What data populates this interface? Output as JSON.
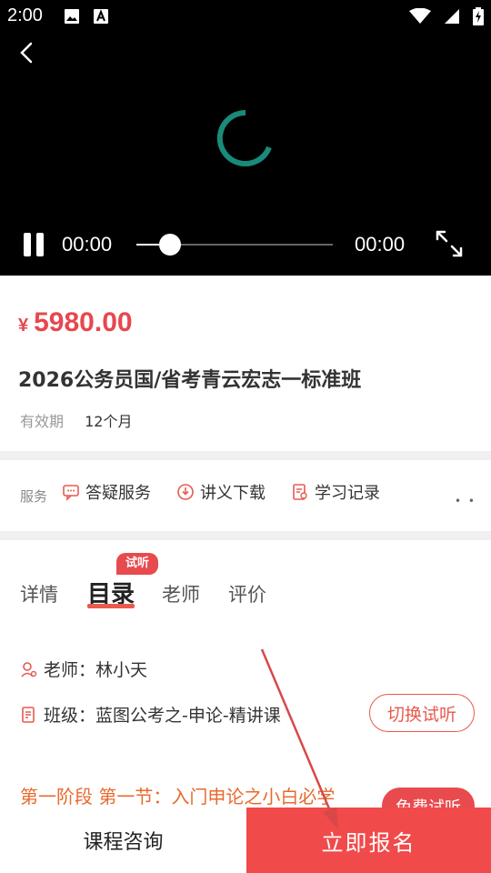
{
  "status_bar": {
    "time": "2:00"
  },
  "player": {
    "current_time": "00:00",
    "duration": "00:00",
    "progress_fraction": 0.17,
    "accent_color": "#1a8a7a"
  },
  "course": {
    "currency": "¥",
    "price": "5980.00",
    "title": "2026公务员国/省考青云宏志一标准班",
    "validity_label": "有效期",
    "validity_value": "12个月"
  },
  "services": {
    "label": "服务",
    "items": [
      {
        "label": "答疑服务",
        "icon": "chat-icon"
      },
      {
        "label": "讲义下载",
        "icon": "download-icon"
      },
      {
        "label": "学习记录",
        "icon": "record-icon"
      }
    ],
    "more": "• •"
  },
  "tabs": {
    "items": [
      "详情",
      "目录",
      "老师",
      "评价"
    ],
    "active_index": 1,
    "badge": "试听"
  },
  "catalog": {
    "teacher_label": "老师：林小天",
    "class_label": "班级：蓝图公考之-申论-精讲课",
    "switch_button": "切换试听",
    "lesson": "第一阶段 第一节：入门申论之小白必学",
    "free_button": "免费试听"
  },
  "bottom_bar": {
    "consult": "课程咨询",
    "enroll": "立即报名"
  },
  "colors": {
    "brand_red": "#f04a4a",
    "price_red": "#e8474e",
    "lesson_orange": "#e86a2e"
  }
}
